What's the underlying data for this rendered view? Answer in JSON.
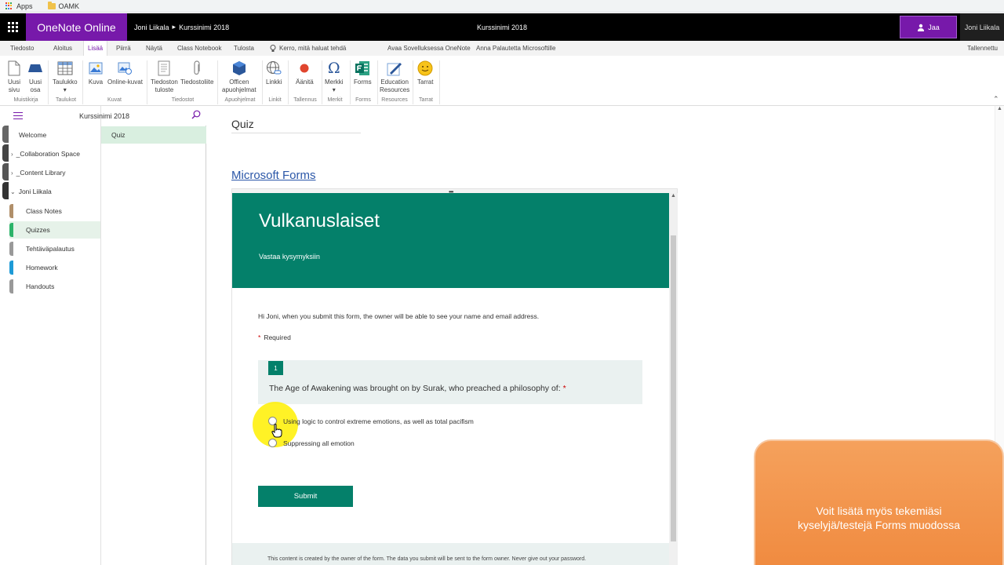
{
  "bookmarks": {
    "apps_label": "Apps",
    "folder_label": "OAMK"
  },
  "appbar": {
    "app_name": "OneNote Online",
    "breadcrumb_user": "Joni Liikala",
    "breadcrumb_sep": "▸",
    "breadcrumb_notebook": "Kurssinimi 2018",
    "notebook_center": "Kurssinimi 2018",
    "share_label": "Jaa",
    "user_name": "Joni Liikala"
  },
  "tabs": {
    "file": "Tiedosto",
    "home": "Aloitus",
    "insert": "Lisää",
    "draw": "Piirrä",
    "view": "Näytä",
    "class_notebook": "Class Notebook",
    "print": "Tulosta",
    "tell_me": "Kerro, mitä haluat tehdä",
    "open_app": "Avaa Sovelluksessa OneNote",
    "feedback": "Anna Palautetta Microsoftille",
    "saved": "Tallennettu"
  },
  "ribbon": {
    "new_page": [
      "Uusi",
      "sivu"
    ],
    "new_section": [
      "Uusi",
      "osa"
    ],
    "group_notebook": "Muistikirja",
    "table": "Taulukko",
    "group_tables": "Taulukot",
    "picture": "Kuva",
    "online_pictures": "Online-kuvat",
    "group_images": "Kuvat",
    "file_printout": [
      "Tiedoston",
      "tuloste"
    ],
    "file_attachment": "Tiedostoliite",
    "group_files": "Tiedostot",
    "office_addins": [
      "Officen",
      "apuohjelmat"
    ],
    "group_addins": "Apuohjelmat",
    "link": "Linkki",
    "group_links": "Linkit",
    "record": "Äänitä",
    "group_recording": "Tallennus",
    "symbol": "Merkki",
    "group_symbols": "Merkit",
    "forms": "Forms",
    "group_forms": "Forms",
    "education": [
      "Education",
      "Resources"
    ],
    "group_resources": "Resources",
    "stickers": "Tarrat",
    "group_stickers": "Tarrat"
  },
  "nav": {
    "notebook": "Kurssinimi 2018",
    "sections": [
      {
        "label": "Welcome",
        "color": ""
      },
      {
        "label": "_Collaboration Space",
        "color": ""
      },
      {
        "label": "_Content Library",
        "color": ""
      },
      {
        "label": "Joni Liikala",
        "color": ""
      },
      {
        "label": "Class Notes",
        "color": "#b08f6a"
      },
      {
        "label": "Quizzes",
        "color": "#2db36a"
      },
      {
        "label": "Tehtäväpalautus",
        "color": "#999999"
      },
      {
        "label": "Homework",
        "color": "#1d9ad6"
      },
      {
        "label": "Handouts",
        "color": "#999999"
      }
    ],
    "pages": [
      "Quiz"
    ]
  },
  "page": {
    "title": "Quiz",
    "link": "Microsoft Forms",
    "form": {
      "title": "Vulkanuslaiset",
      "subtitle": "Vastaa kysymyksiin",
      "notice": "Hi Joni, when you submit this form, the owner will be able to see your name and email address.",
      "required_mark": "*",
      "required_label": "Required",
      "question_number": "1",
      "question": "The Age of Awakening was brought on by Surak, who preached a philosophy of:",
      "options": [
        "Using logic to control extreme emotions, as well as total pacifism",
        "Suppressing all emotion"
      ],
      "submit": "Submit",
      "footer": "This content is created by the owner of the form. The data you submit will be sent to the form owner. Never give out your password."
    }
  },
  "overlay": {
    "line1": "Voit lisätä myös tekemiäsi",
    "line2": "kyselyjä/testejä Forms muodossa"
  },
  "colors": {
    "onenote_purple": "#7719aa",
    "forms_teal": "#04806a",
    "overlay_orange": "#f08a3f"
  }
}
